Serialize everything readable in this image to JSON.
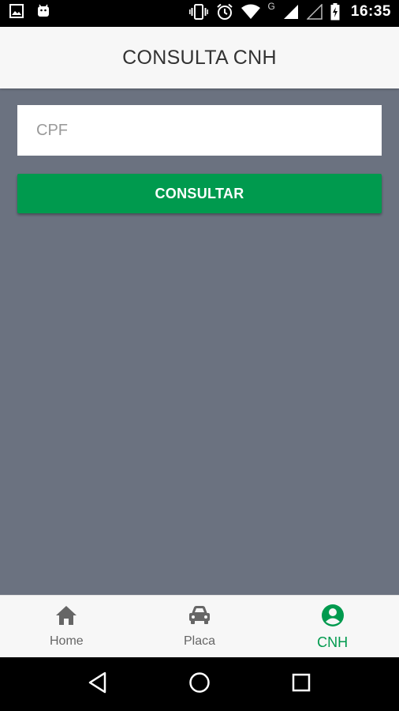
{
  "status_bar": {
    "time": "16:35",
    "network_label": "G",
    "icons": [
      "image-icon",
      "android-icon",
      "vibrate-icon",
      "alarm-icon",
      "wifi-icon",
      "signal-icon",
      "signal-empty-icon",
      "battery-charging-icon"
    ]
  },
  "header": {
    "title": "CONSULTA CNH"
  },
  "form": {
    "cpf_placeholder": "CPF",
    "cpf_value": "",
    "submit_label": "CONSULTAR"
  },
  "bottom_nav": {
    "items": [
      {
        "label": "Home",
        "icon": "home-icon",
        "active": false
      },
      {
        "label": "Placa",
        "icon": "car-icon",
        "active": false
      },
      {
        "label": "CNH",
        "icon": "account-circle-icon",
        "active": true
      }
    ]
  },
  "colors": {
    "accent": "#009a4e",
    "background": "#6b7280",
    "header_bg": "#f7f7f7"
  }
}
